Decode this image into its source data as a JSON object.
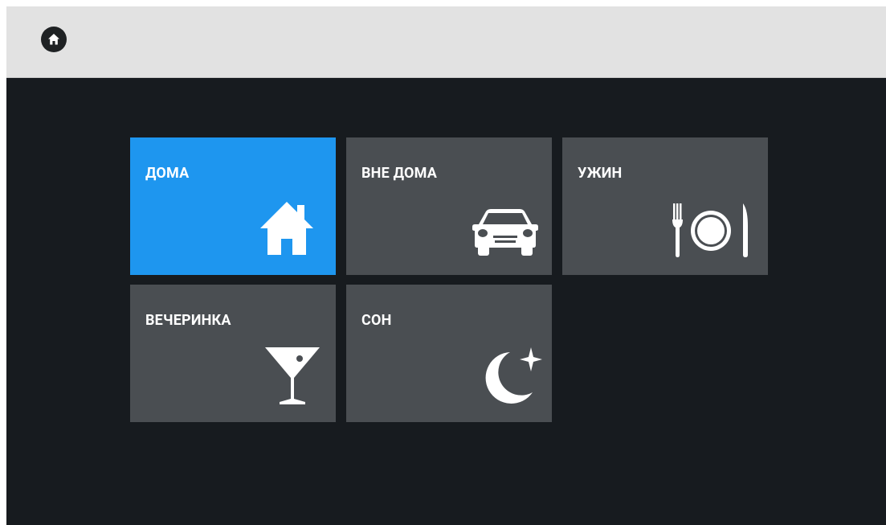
{
  "topbar": {
    "home_icon": "home-icon"
  },
  "scenes": [
    {
      "label": "ДОМА",
      "icon": "house-icon",
      "active": true
    },
    {
      "label": "ВНЕ ДОМА",
      "icon": "car-icon",
      "active": false
    },
    {
      "label": "УЖИН",
      "icon": "fork-plate-knife-icon",
      "active": false
    },
    {
      "label": "ВЕЧЕРИНКА",
      "icon": "cocktail-glass-icon",
      "active": false
    },
    {
      "label": "СОН",
      "icon": "moon-star-icon",
      "active": false
    }
  ],
  "colors": {
    "background": "#171b1f",
    "topbar": "#e2e2e2",
    "tile": "#4a4e52",
    "tile_active": "#1e96ef",
    "text": "#ffffff"
  }
}
